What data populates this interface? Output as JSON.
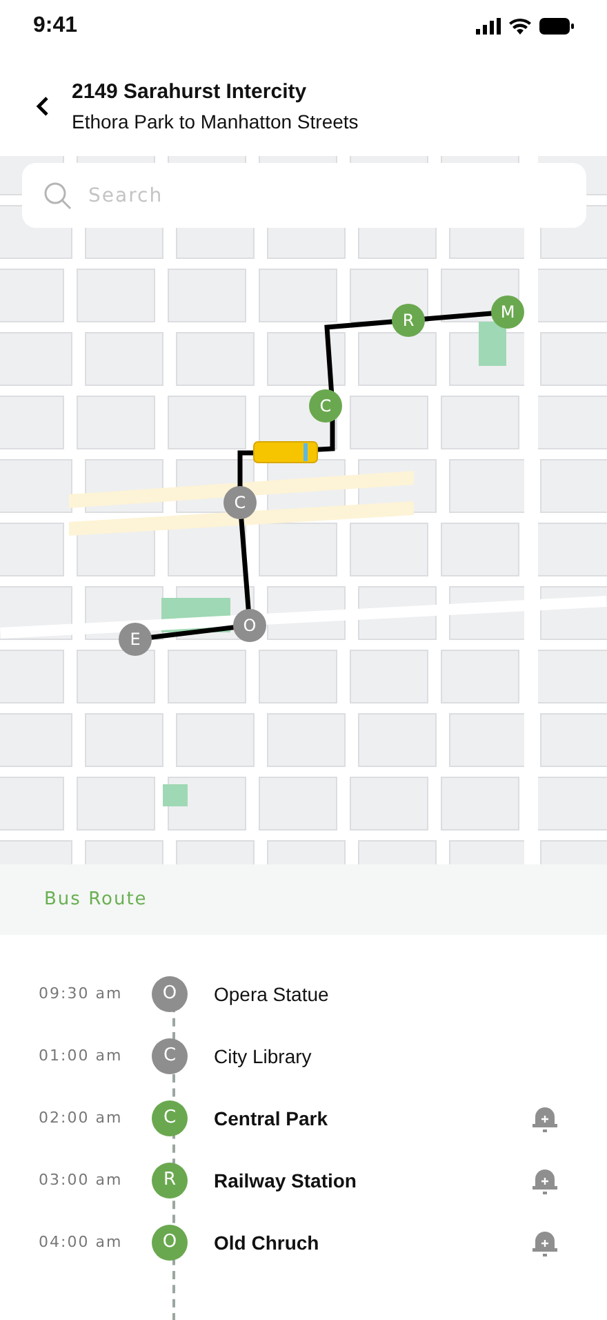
{
  "status_bar": {
    "time": "9:41"
  },
  "header": {
    "title": "2149 Sarahurst Intercity",
    "subtitle": "Ethora Park to Manhatton Streets"
  },
  "search": {
    "placeholder": "Search"
  },
  "map": {
    "stops": [
      {
        "label": "E",
        "passed": true
      },
      {
        "label": "O",
        "passed": true
      },
      {
        "label": "C",
        "passed": true
      },
      {
        "label": "C",
        "passed": false
      },
      {
        "label": "R",
        "passed": false
      },
      {
        "label": "M",
        "passed": false
      }
    ]
  },
  "route": {
    "title": "Bus Route",
    "stops": [
      {
        "time": "09:30 am",
        "letter": "O",
        "name": "Opera Statue",
        "passed": true
      },
      {
        "time": "01:00 am",
        "letter": "C",
        "name": "City Library",
        "passed": true
      },
      {
        "time": "02:00 am",
        "letter": "C",
        "name": "Central Park",
        "passed": false
      },
      {
        "time": "03:00 am",
        "letter": "R",
        "name": "Railway Station",
        "passed": false
      },
      {
        "time": "04:00 am",
        "letter": "O",
        "name": "Old Chruch",
        "passed": false
      }
    ]
  }
}
